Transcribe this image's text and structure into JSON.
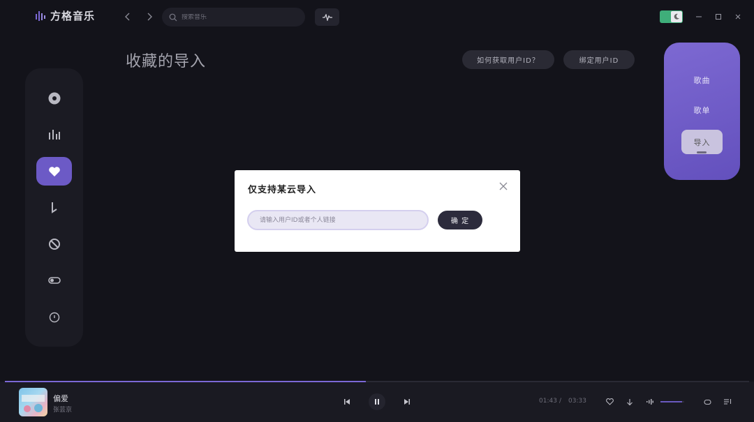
{
  "app": {
    "name": "方格音乐"
  },
  "search": {
    "placeholder": "搜索音乐"
  },
  "page": {
    "title": "收藏的导入",
    "help_button": "如何获取用户ID？",
    "bind_button": "绑定用户ID"
  },
  "right_panel": {
    "items": [
      "歌曲",
      "歌单",
      "导入"
    ],
    "active": "导入"
  },
  "sidebar": {
    "items": [
      "disc-icon",
      "chart-icon",
      "heart-icon",
      "music-note-icon",
      "no-entry-icon",
      "toggle-icon",
      "circle-icon"
    ],
    "active_index": 2
  },
  "modal": {
    "title": "仅支持某云导入",
    "input_placeholder": "请输入用户ID或者个人链接",
    "input_value": "",
    "confirm_label": "确 定"
  },
  "player": {
    "song_title": "偏爱",
    "artist": "张芸京",
    "current_time": "01:43",
    "separator": "/",
    "total_time": "03:33",
    "progress": 0.485,
    "volume": 0.9
  },
  "colors": {
    "accent": "#6c5ac6",
    "theme_toggle": "#3fae7a",
    "background": "#13131a"
  }
}
